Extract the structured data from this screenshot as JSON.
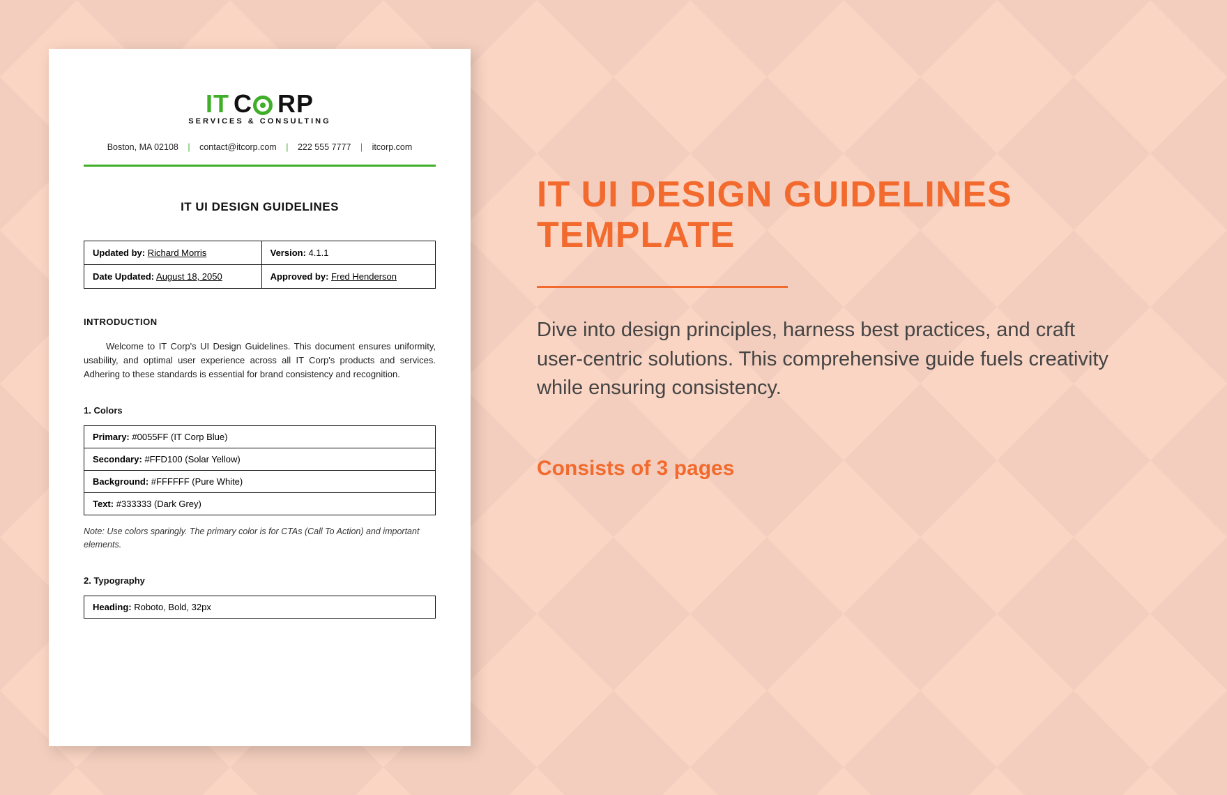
{
  "page": {
    "logo": {
      "it": "IT",
      "corp": "C",
      "corp2": "RP",
      "sub": "SERVICES & CONSULTING"
    },
    "contact": {
      "address": "Boston, MA 02108",
      "email": "contact@itcorp.com",
      "phone": "222 555 7777",
      "site": "itcorp.com"
    },
    "title": "IT UI DESIGN GUIDELINES",
    "meta": {
      "updated_by_label": "Updated by:",
      "updated_by": "Richard Morris",
      "version_label": "Version:",
      "version": "4.1.1",
      "date_updated_label": "Date Updated:",
      "date_updated": "August 18, 2050",
      "approved_by_label": "Approved by:",
      "approved_by": "Fred Henderson"
    },
    "intro_head": "INTRODUCTION",
    "intro_body": "Welcome to IT Corp's UI Design Guidelines. This document ensures uniformity, usability, and optimal user experience across all IT Corp's products and services. Adhering to these standards is essential for brand consistency and recognition.",
    "sections": {
      "colors": {
        "head": "1. Colors",
        "rows": [
          {
            "label": "Primary:",
            "value": "#0055FF (IT Corp Blue)"
          },
          {
            "label": "Secondary:",
            "value": "#FFD100 (Solar Yellow)"
          },
          {
            "label": "Background:",
            "value": "#FFFFFF (Pure White)"
          },
          {
            "label": "Text:",
            "value": "#333333 (Dark Grey)"
          }
        ],
        "note": "Note: Use colors sparingly. The primary color is for CTAs (Call To Action) and important elements."
      },
      "typography": {
        "head": "2. Typography",
        "rows": [
          {
            "label": "Heading:",
            "value": "Roboto, Bold, 32px"
          }
        ]
      }
    }
  },
  "panel": {
    "title": "IT UI DESIGN GUIDELINES TEMPLATE",
    "desc": "Dive into design principles, harness best practices, and craft user-centric solutions. This comprehensive guide fuels creativity while ensuring consistency.",
    "pages": "Consists of 3 pages"
  }
}
